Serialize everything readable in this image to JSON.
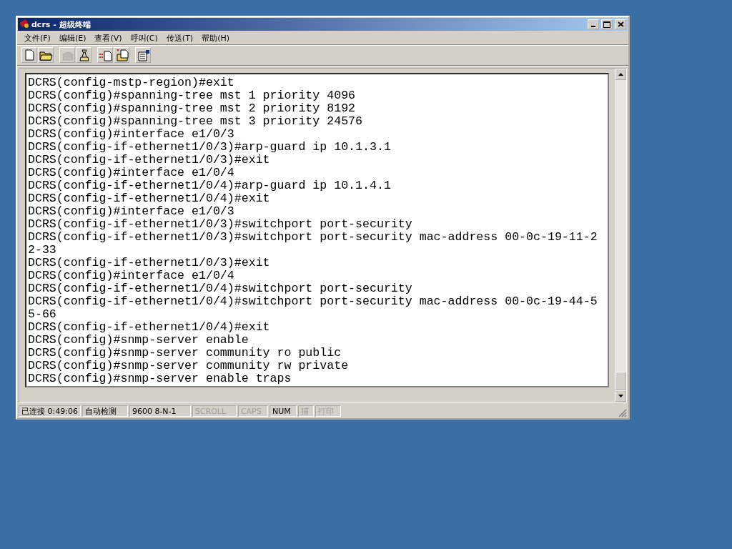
{
  "window": {
    "title": "dcrs - 超级终端"
  },
  "menu": [
    {
      "label": "文件(F)"
    },
    {
      "label": "编辑(E)"
    },
    {
      "label": "查看(V)"
    },
    {
      "label": "呼叫(C)"
    },
    {
      "label": "传送(T)"
    },
    {
      "label": "帮助(H)"
    }
  ],
  "toolbar": [
    [
      {
        "kind": "new",
        "disabled": false
      },
      {
        "kind": "open",
        "disabled": false
      }
    ],
    [
      {
        "kind": "phone",
        "disabled": true
      },
      {
        "kind": "hangup",
        "disabled": false
      }
    ],
    [
      {
        "kind": "send",
        "disabled": false
      },
      {
        "kind": "receive",
        "disabled": false
      }
    ],
    [
      {
        "kind": "properties",
        "disabled": false
      }
    ]
  ],
  "terminal": {
    "lines": [
      "DCRS(config-mstp-region)#exit",
      "DCRS(config)#spanning-tree mst 1 priority 4096",
      "DCRS(config)#spanning-tree mst 2 priority 8192",
      "DCRS(config)#spanning-tree mst 3 priority 24576",
      "DCRS(config)#interface e1/0/3",
      "DCRS(config-if-ethernet1/0/3)#arp-guard ip 10.1.3.1",
      "DCRS(config-if-ethernet1/0/3)#exit",
      "DCRS(config)#interface e1/0/4",
      "DCRS(config-if-ethernet1/0/4)#arp-guard ip 10.1.4.1",
      "DCRS(config-if-ethernet1/0/4)#exit",
      "DCRS(config)#interface e1/0/3",
      "DCRS(config-if-ethernet1/0/3)#switchport port-security",
      "DCRS(config-if-ethernet1/0/3)#switchport port-security mac-address 00-0c-19-11-2",
      "2-33",
      "DCRS(config-if-ethernet1/0/3)#exit",
      "DCRS(config)#interface e1/0/4",
      "DCRS(config-if-ethernet1/0/4)#switchport port-security",
      "DCRS(config-if-ethernet1/0/4)#switchport port-security mac-address 00-0c-19-44-5",
      "5-66",
      "DCRS(config-if-ethernet1/0/4)#exit",
      "DCRS(config)#snmp-server enable",
      "DCRS(config)#snmp-server community ro public",
      "DCRS(config)#snmp-server community rw private",
      "DCRS(config)#snmp-server enable traps"
    ]
  },
  "status_bar": [
    {
      "text": "已连接 0:49:06",
      "active": true
    },
    {
      "text": "自动检测",
      "active": true
    },
    {
      "text": "9600 8-N-1",
      "active": true
    },
    {
      "text": "SCROLL",
      "active": false
    },
    {
      "text": "CAPS",
      "active": false
    },
    {
      "text": "NUM",
      "active": true
    },
    {
      "text": "捕",
      "active": false
    },
    {
      "text": "打印",
      "active": false
    }
  ]
}
